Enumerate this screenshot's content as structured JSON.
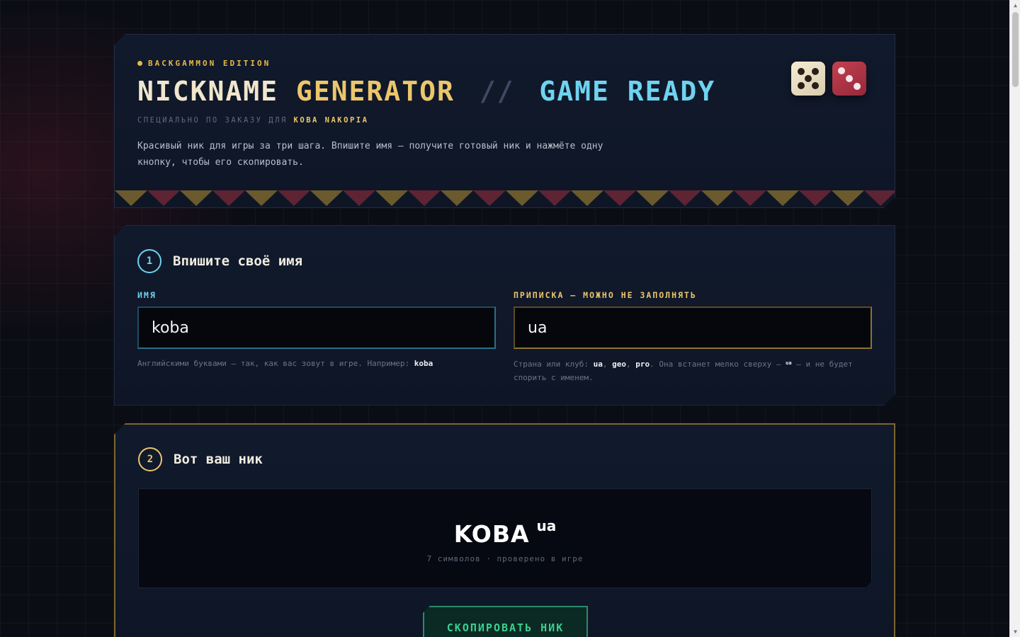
{
  "header": {
    "edition": "BACKGAMMON EDITION",
    "title_nickname": "NICKNAME",
    "title_generator": "GENERATOR",
    "title_separator": "//",
    "title_game": "GAME",
    "title_ready": "READY",
    "subtitle_prefix": "СПЕЦИАЛЬНО ПО ЗАКАЗУ ДЛЯ",
    "subtitle_name": "KOBA NAKOPIA",
    "description": "Красивый ник для игры за три шага. Впишите имя — получите готовый ник и нажмёте одну кнопку, чтобы его скопировать.",
    "colors": {
      "gold": "#ecc66a",
      "cyan": "#6fd3f0",
      "red_die": "#b33445",
      "white_die": "#efe3c6"
    }
  },
  "step1": {
    "number": "1",
    "title": "Впишите своё имя",
    "name_label": "ИМЯ",
    "name_value": "koba",
    "name_hint_text": "Английскими буквами — так, как вас зовут в игре. Например:",
    "name_hint_example": "koba",
    "tag_label": "ПРИПИСКА — МОЖНО НЕ ЗАПОЛНЯТЬ",
    "tag_value": "ua",
    "tag_hint_intro": "Страна или клуб:",
    "tag_hint_ex1": "ua",
    "tag_hint_ex2": "geo",
    "tag_hint_ex3": "pro",
    "tag_hint_mid": ". Она встанет мелко сверху —",
    "tag_hint_mini": "ua",
    "tag_hint_end": "— и не будет спорить с именем."
  },
  "step2": {
    "number": "2",
    "title": "Вот ваш ник",
    "nick_main": "KOBA",
    "nick_sup": "ua",
    "meta": "7 символов · проверено в игре",
    "copy_label": "СКОПИРОВАТЬ НИК"
  }
}
